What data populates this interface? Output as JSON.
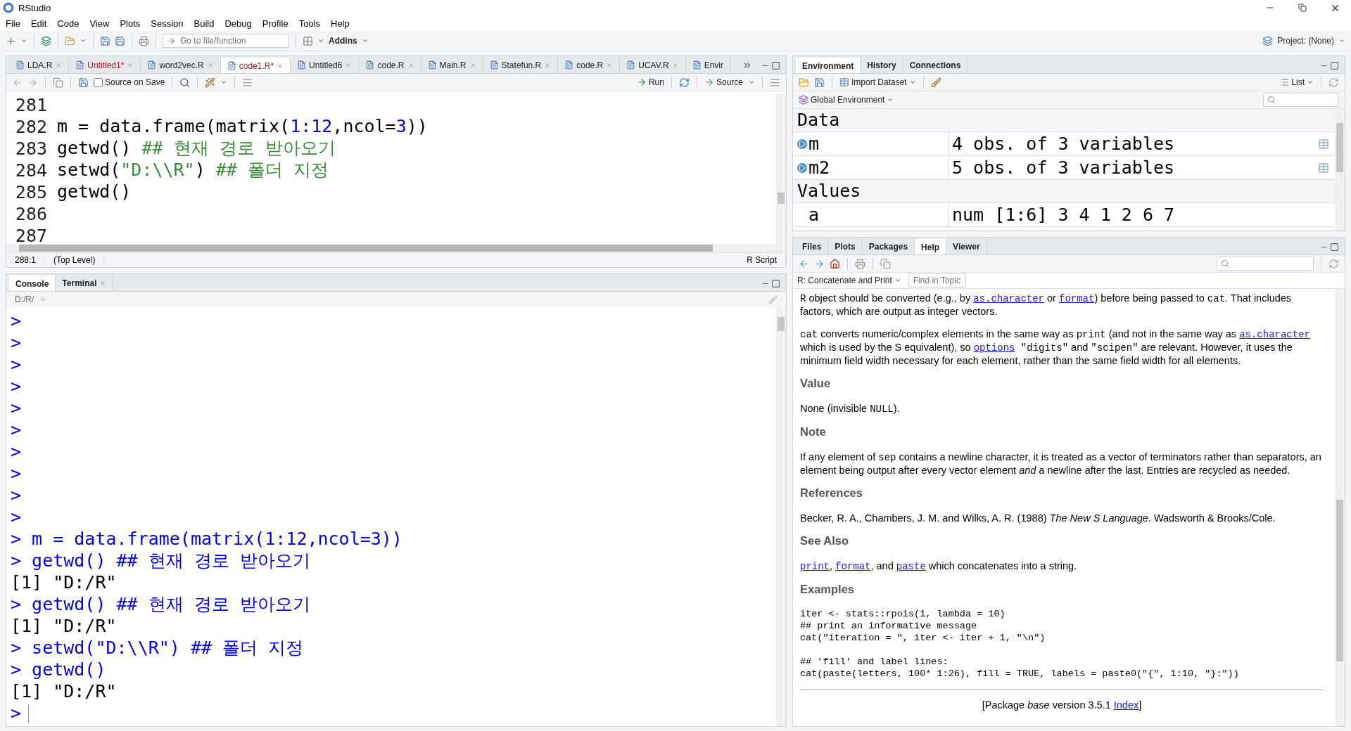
{
  "window": {
    "title": "RStudio"
  },
  "menu": [
    "File",
    "Edit",
    "Code",
    "View",
    "Plots",
    "Session",
    "Build",
    "Debug",
    "Profile",
    "Tools",
    "Help"
  ],
  "toolbar": {
    "goto_placeholder": "Go to file/function",
    "addins": "Addins",
    "project": "Project: (None)"
  },
  "editor": {
    "tabs": [
      {
        "label": "LDA.R",
        "selected": false,
        "modified": false
      },
      {
        "label": "Untitled1*",
        "selected": false,
        "modified": true
      },
      {
        "label": "word2vec.R",
        "selected": false,
        "modified": false
      },
      {
        "label": "code1.R*",
        "selected": true,
        "modified": true
      },
      {
        "label": "Untitled6",
        "selected": false,
        "modified": false
      },
      {
        "label": "code.R",
        "selected": false,
        "modified": false
      },
      {
        "label": "Main.R",
        "selected": false,
        "modified": false
      },
      {
        "label": "Statefun.R",
        "selected": false,
        "modified": false
      },
      {
        "label": "code.R",
        "selected": false,
        "modified": false
      },
      {
        "label": "UCAV.R",
        "selected": false,
        "modified": false
      },
      {
        "label": "Envir",
        "selected": false,
        "modified": false
      }
    ],
    "source_on_save": {
      "label": "Source on Save",
      "checked": false
    },
    "run": "Run",
    "source": "Source",
    "lines": [
      {
        "number": "281"
      },
      {
        "number": "282",
        "segments": [
          {
            "text": "m = data.frame(matrix(",
            "kind": "plain"
          },
          {
            "text": "1:12",
            "kind": "number"
          },
          {
            "text": ",ncol=",
            "kind": "plain"
          },
          {
            "text": "3",
            "kind": "number"
          },
          {
            "text": "))",
            "kind": "plain"
          }
        ]
      },
      {
        "number": "283",
        "segments": [
          {
            "text": "getwd() ",
            "kind": "plain"
          },
          {
            "text": "## 현재 경로 받아오기",
            "kind": "comment"
          }
        ]
      },
      {
        "number": "284",
        "segments": [
          {
            "text": "setwd(",
            "kind": "plain"
          },
          {
            "text": "\"D:\\\\R\"",
            "kind": "string"
          },
          {
            "text": ") ",
            "kind": "plain"
          },
          {
            "text": "## 폴더 지정",
            "kind": "comment"
          }
        ]
      },
      {
        "number": "285",
        "segments": [
          {
            "text": "getwd()",
            "kind": "plain"
          }
        ]
      },
      {
        "number": "286"
      },
      {
        "number": "287"
      }
    ],
    "status": {
      "position": "288:1",
      "scope": "(Top Level)",
      "filetype": "R Script"
    }
  },
  "console": {
    "tabs": [
      {
        "label": "Console",
        "selected": true,
        "closable": false
      },
      {
        "label": "Terminal",
        "selected": false,
        "closable": true
      }
    ],
    "path": "D:/R/",
    "lines": [
      {
        "kind": "input",
        "prompt": ">"
      },
      {
        "kind": "input",
        "prompt": ">"
      },
      {
        "kind": "input",
        "prompt": ">"
      },
      {
        "kind": "input",
        "prompt": ">"
      },
      {
        "kind": "input",
        "prompt": ">"
      },
      {
        "kind": "input",
        "prompt": ">"
      },
      {
        "kind": "input",
        "prompt": ">"
      },
      {
        "kind": "input",
        "prompt": ">"
      },
      {
        "kind": "input",
        "prompt": ">"
      },
      {
        "kind": "input",
        "prompt": ">"
      },
      {
        "kind": "input",
        "prompt": ">",
        "text": "m = data.frame(matrix(1:12,ncol=3))"
      },
      {
        "kind": "input",
        "prompt": ">",
        "text": "getwd() ## 현재 경로 받아오기"
      },
      {
        "kind": "output",
        "text": "[1] \"D:/R\""
      },
      {
        "kind": "input",
        "prompt": ">",
        "text": "getwd() ## 현재 경로 받아오기"
      },
      {
        "kind": "output",
        "text": "[1] \"D:/R\""
      },
      {
        "kind": "input",
        "prompt": ">",
        "text": "setwd(\"D:\\\\R\") ## 폴더 지정"
      },
      {
        "kind": "input",
        "prompt": ">",
        "text": "getwd()"
      },
      {
        "kind": "output",
        "text": "[1] \"D:/R\""
      },
      {
        "kind": "cursor",
        "prompt": ">"
      }
    ]
  },
  "environment": {
    "tabs": [
      {
        "label": "Environment",
        "selected": true
      },
      {
        "label": "History",
        "selected": false
      },
      {
        "label": "Connections",
        "selected": false
      }
    ],
    "import": "Import Dataset",
    "view": "List",
    "scope": "Global Environment",
    "sections": [
      {
        "title": "Data",
        "rows": [
          {
            "name": "m",
            "value": "4 obs. of 3 variables",
            "kind": "data"
          },
          {
            "name": "m2",
            "value": "5 obs. of 3 variables",
            "kind": "data"
          }
        ]
      },
      {
        "title": "Values",
        "rows": [
          {
            "name": "a",
            "value": "num [1:6] 3 4 1 2 6 7",
            "kind": "value"
          }
        ]
      }
    ]
  },
  "files": {
    "tabs": [
      {
        "label": "Files",
        "selected": false
      },
      {
        "label": "Plots",
        "selected": false
      },
      {
        "label": "Packages",
        "selected": false
      },
      {
        "label": "Help",
        "selected": true
      },
      {
        "label": "Viewer",
        "selected": false
      }
    ],
    "topic": "R: Concatenate and Print",
    "find_placeholder": "Find in Topic",
    "help": [
      {
        "kind": "para",
        "segments": [
          {
            "text": "R",
            "kind": "code"
          },
          {
            "text": " object should be converted (e.g., by ",
            "kind": "text"
          },
          {
            "text": "as.character",
            "kind": "link"
          },
          {
            "text": " or ",
            "kind": "text"
          },
          {
            "text": "format",
            "kind": "link"
          },
          {
            "text": ") before being passed to ",
            "kind": "text"
          },
          {
            "text": "cat",
            "kind": "code"
          },
          {
            "text": ". That includes factors, which are output as integer vectors.",
            "kind": "text"
          }
        ]
      },
      {
        "kind": "para",
        "segments": [
          {
            "text": "cat",
            "kind": "code"
          },
          {
            "text": " converts numeric/complex elements in the same way as ",
            "kind": "text"
          },
          {
            "text": "print",
            "kind": "code"
          },
          {
            "text": " (and not in the same way as ",
            "kind": "text"
          },
          {
            "text": "as.character",
            "kind": "link"
          },
          {
            "text": " which is used by the S equivalent), so ",
            "kind": "text"
          },
          {
            "text": "options",
            "kind": "link"
          },
          {
            "text": " \"digits\"",
            "kind": "code"
          },
          {
            "text": " and ",
            "kind": "text"
          },
          {
            "text": "\"scipen\"",
            "kind": "code"
          },
          {
            "text": " are relevant. However, it uses the minimum field width necessary for each element, rather than the same field width for all elements.",
            "kind": "text"
          }
        ]
      },
      {
        "kind": "heading",
        "text": "Value"
      },
      {
        "kind": "para",
        "segments": [
          {
            "text": "None (invisible ",
            "kind": "text"
          },
          {
            "text": "NULL",
            "kind": "code"
          },
          {
            "text": ").",
            "kind": "text"
          }
        ]
      },
      {
        "kind": "heading",
        "text": "Note"
      },
      {
        "kind": "para",
        "segments": [
          {
            "text": "If any element of ",
            "kind": "text"
          },
          {
            "text": "sep",
            "kind": "code"
          },
          {
            "text": " contains a newline character, it is treated as a vector of terminators rather than separators, an element being output after every vector element ",
            "kind": "text"
          },
          {
            "text": "and",
            "kind": "italic"
          },
          {
            "text": " a newline after the last. Entries are recycled as needed.",
            "kind": "text"
          }
        ]
      },
      {
        "kind": "heading",
        "text": "References"
      },
      {
        "kind": "para",
        "segments": [
          {
            "text": "Becker, R. A., Chambers, J. M. and Wilks, A. R. (1988) ",
            "kind": "text"
          },
          {
            "text": "The New S Language",
            "kind": "italic"
          },
          {
            "text": ". Wadsworth & Brooks/Cole.",
            "kind": "text"
          }
        ]
      },
      {
        "kind": "heading",
        "text": "See Also"
      },
      {
        "kind": "para",
        "segments": [
          {
            "text": "print",
            "kind": "link"
          },
          {
            "text": ", ",
            "kind": "text"
          },
          {
            "text": "format",
            "kind": "link"
          },
          {
            "text": ", and ",
            "kind": "text"
          },
          {
            "text": "paste",
            "kind": "link"
          },
          {
            "text": " which concatenates into a string.",
            "kind": "text"
          }
        ]
      },
      {
        "kind": "heading",
        "text": "Examples"
      },
      {
        "kind": "code",
        "lines": [
          "iter <- stats::rpois(1, lambda = 10)",
          "## print an informative message",
          "cat(\"iteration = \", iter <- iter + 1, \"\\n\")",
          "## 'fill' and label lines:",
          "cat(paste(letters, 100* 1:26), fill = TRUE, labels = paste0(\"{\", 1:10, \"}:\"))"
        ]
      },
      {
        "kind": "footer",
        "segments": [
          {
            "text": "[Package ",
            "kind": "text"
          },
          {
            "text": "base",
            "kind": "italic"
          },
          {
            "text": " version 3.5.1 ",
            "kind": "text"
          },
          {
            "text": "Index",
            "kind": "textlink"
          },
          {
            "text": "]",
            "kind": "text"
          }
        ]
      }
    ]
  }
}
